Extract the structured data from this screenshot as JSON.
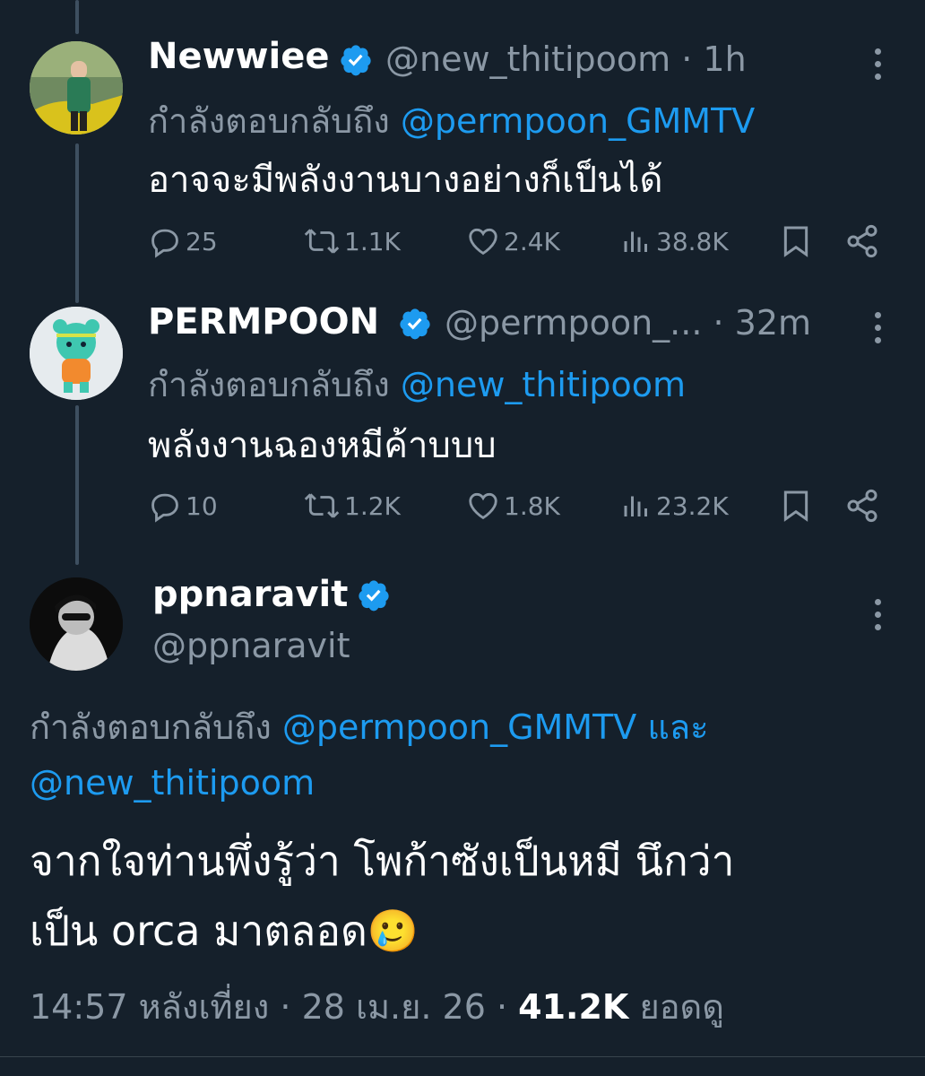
{
  "colors": {
    "background": "#15202b",
    "accent": "#1d9bf0",
    "muted": "#8b98a5",
    "text": "#ffffff"
  },
  "tweets": [
    {
      "name": "Newwiee",
      "handle": "@new_thitipoom · 1h",
      "reply_prefix": "กำลังตอบกลับถึง",
      "reply_to": "@permpoon_GMMTV",
      "text": "อาจจะมีพลังงานบางอย่างก็เป็นได้",
      "stats": {
        "replies": "25",
        "retweets": "1.1K",
        "likes": "2.4K",
        "views": "38.8K"
      }
    },
    {
      "name": "PERMPOON",
      "handle": "@permpoon_... · 32m",
      "reply_prefix": "กำลังตอบกลับถึง",
      "reply_to": "@new_thitipoom",
      "text": "พลังงานฉองหมีค้าบบบ",
      "stats": {
        "replies": "10",
        "retweets": "1.2K",
        "likes": "1.8K",
        "views": "23.2K"
      }
    }
  ],
  "main": {
    "name": "ppnaravit",
    "handle": "@ppnaravit",
    "reply_prefix": "กำลังตอบกลับถึง",
    "reply_to_1": "@permpoon_GMMTV",
    "reply_and": "และ",
    "reply_to_2": "@new_thitipoom",
    "text_line1": "จากใจท่านพึ่งรู้ว่า โพก้าซังเป็นหมี นึกว่า",
    "text_line2": "เป็น orca มาตลอด",
    "emoji": "🥲",
    "time_date": "14:57 หลังเที่ยง · 28 เม.ย. 26 ·",
    "views_count": "41.2K",
    "views_label": "ยอดดู"
  }
}
